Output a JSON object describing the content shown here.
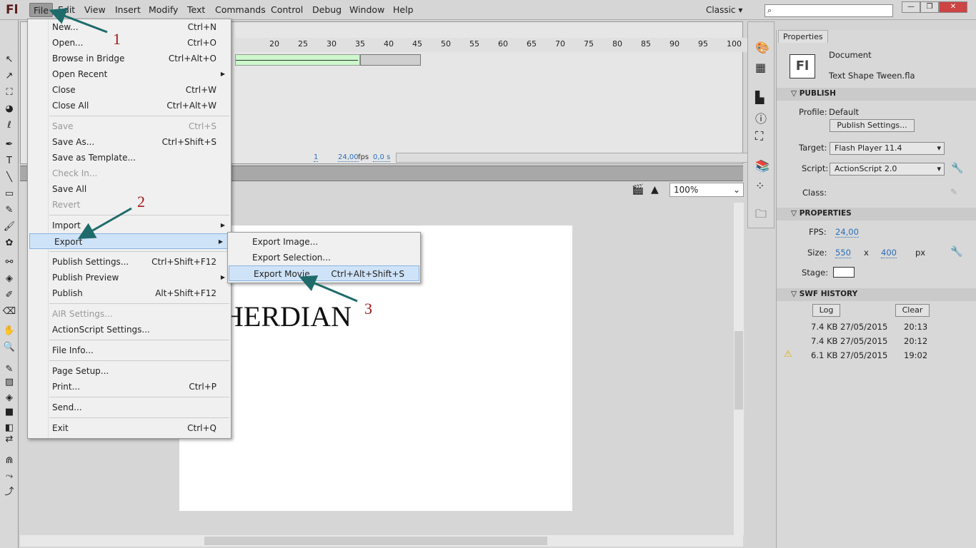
{
  "app": {
    "logo": "Fl",
    "workspace": "Classic",
    "search_placeholder": ""
  },
  "menubar": [
    "File",
    "Edit",
    "View",
    "Insert",
    "Modify",
    "Text",
    "Commands",
    "Control",
    "Debug",
    "Window",
    "Help"
  ],
  "file_menu": [
    {
      "label": "New...",
      "shortcut": "Ctrl+N"
    },
    {
      "label": "Open...",
      "shortcut": "Ctrl+O"
    },
    {
      "label": "Browse in Bridge",
      "shortcut": "Ctrl+Alt+O"
    },
    {
      "label": "Open Recent",
      "submenu": true
    },
    {
      "label": "Close",
      "shortcut": "Ctrl+W"
    },
    {
      "label": "Close All",
      "shortcut": "Ctrl+Alt+W"
    },
    {
      "sep": true
    },
    {
      "label": "Save",
      "shortcut": "Ctrl+S",
      "disabled": true
    },
    {
      "label": "Save As...",
      "shortcut": "Ctrl+Shift+S"
    },
    {
      "label": "Save as Template..."
    },
    {
      "label": "Check In...",
      "disabled": true
    },
    {
      "label": "Save All"
    },
    {
      "label": "Revert",
      "disabled": true
    },
    {
      "sep": true
    },
    {
      "label": "Import",
      "submenu": true
    },
    {
      "label": "Export",
      "submenu": true,
      "highlighted": true
    },
    {
      "sep": true
    },
    {
      "label": "Publish Settings...",
      "shortcut": "Ctrl+Shift+F12"
    },
    {
      "label": "Publish Preview",
      "submenu": true
    },
    {
      "label": "Publish",
      "shortcut": "Alt+Shift+F12"
    },
    {
      "sep": true
    },
    {
      "label": "AIR Settings...",
      "disabled": true
    },
    {
      "label": "ActionScript Settings..."
    },
    {
      "sep": true
    },
    {
      "label": "File Info..."
    },
    {
      "sep": true
    },
    {
      "label": "Page Setup..."
    },
    {
      "label": "Print...",
      "shortcut": "Ctrl+P"
    },
    {
      "sep": true
    },
    {
      "label": "Send..."
    },
    {
      "sep": true
    },
    {
      "label": "Exit",
      "shortcut": "Ctrl+Q"
    }
  ],
  "export_menu": [
    {
      "label": "Export Image..."
    },
    {
      "label": "Export Selection..."
    },
    {
      "label": "Export Movie...",
      "shortcut": "Ctrl+Alt+Shift+S",
      "highlighted": true
    }
  ],
  "timeline": {
    "ticks": [
      "20",
      "25",
      "30",
      "35",
      "40",
      "45",
      "50",
      "55",
      "60",
      "65",
      "70",
      "75",
      "80",
      "85",
      "90",
      "95",
      "100"
    ],
    "frame": "1",
    "fps": "24,00",
    "fps_unit": "fps",
    "time": "0,0 s"
  },
  "stage": {
    "text": "HERDIAN",
    "zoom": "100%"
  },
  "properties": {
    "tab": "Properties",
    "doc_type": "Document",
    "doc_name": "Text Shape Tween.fla",
    "doc_icon": "Fl",
    "publish": {
      "title": "PUBLISH",
      "profile_label": "Profile:",
      "profile": "Default",
      "settings_button": "Publish Settings...",
      "target_label": "Target:",
      "target": "Flash Player 11.4",
      "script_label": "Script:",
      "script": "ActionScript 2.0",
      "class_label": "Class:"
    },
    "props": {
      "title": "PROPERTIES",
      "fps_label": "FPS:",
      "fps": "24,00",
      "size_label": "Size:",
      "width": "550",
      "x": "x",
      "height": "400",
      "unit": "px",
      "stage_label": "Stage:",
      "stage_color": "#ffffff"
    },
    "history": {
      "title": "SWF HISTORY",
      "log_button": "Log",
      "clear_button": "Clear",
      "rows": [
        {
          "size": "7.4 KB",
          "date": "27/05/2015",
          "time": "20:13",
          "warning": false
        },
        {
          "size": "7.4 KB",
          "date": "27/05/2015",
          "time": "20:12",
          "warning": false
        },
        {
          "size": "6.1 KB",
          "date": "27/05/2015",
          "time": "19:02",
          "warning": true
        }
      ]
    }
  },
  "annotations": [
    "1",
    "2",
    "3"
  ],
  "colors": {
    "arrow": "#1f6b6b",
    "number": "#a01818",
    "tween": "#ccf8cc",
    "link": "#2a6fb8"
  }
}
